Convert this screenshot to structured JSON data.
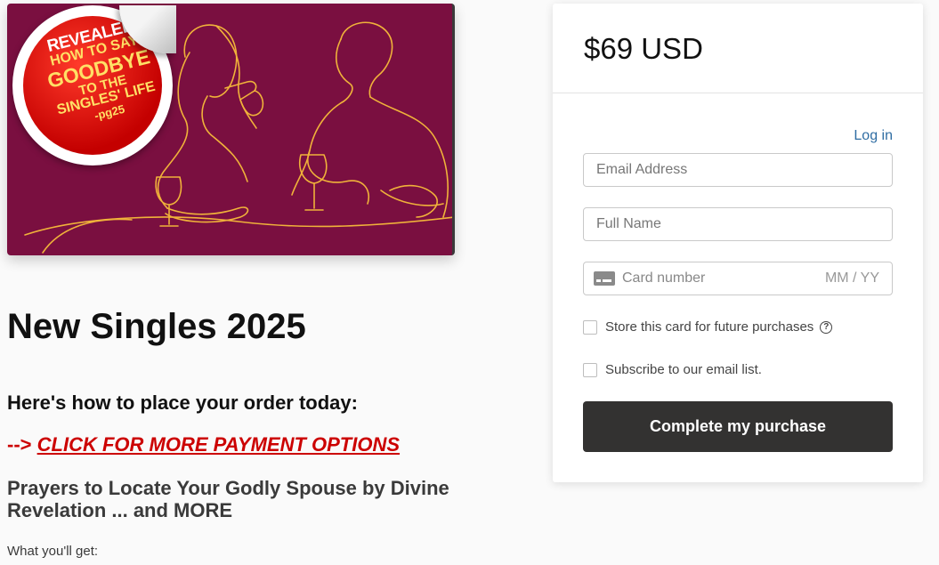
{
  "product": {
    "seal_lines": [
      "REVEALED",
      "HOW TO SAY",
      "GOODBYE",
      "TO THE",
      "SINGLES' LIFE",
      "-pg25"
    ],
    "title": "New Singles 2025",
    "order_heading": "Here's how to place your order today:",
    "payment_arrow": "-->",
    "payment_link": "CLICK FOR MORE PAYMENT OPTIONS",
    "subtitle": "Prayers to Locate Your Godly Spouse by Divine Revelation ... and MORE",
    "what_you_get": "What you'll get:"
  },
  "checkout": {
    "price": "$69 USD",
    "login_label": "Log in",
    "email_placeholder": "Email Address",
    "name_placeholder": "Full Name",
    "card_placeholder": "Card number",
    "expiry_placeholder": "MM / YY",
    "store_card_label": "Store this card for future purchases",
    "subscribe_label": "Subscribe to our email list.",
    "purchase_button": "Complete my purchase"
  },
  "colors": {
    "hero_bg": "#7a0f40",
    "line_art": "#f0b23a",
    "link_red": "#cc0000",
    "login_blue": "#2f6da3",
    "button_dark": "#333231"
  }
}
